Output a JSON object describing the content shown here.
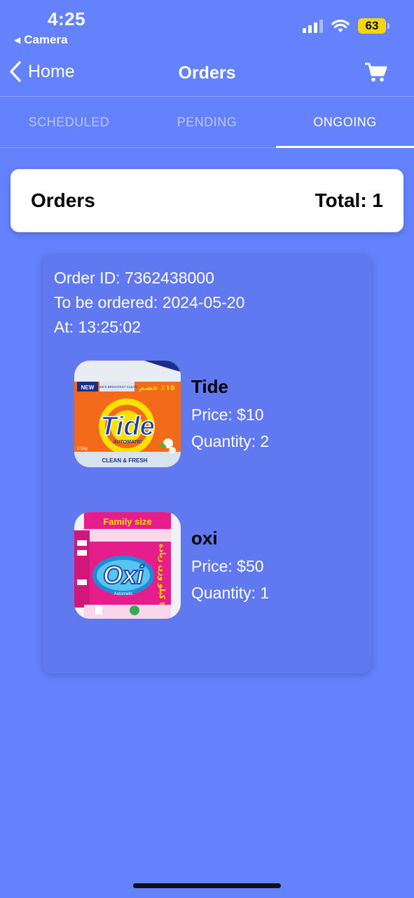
{
  "status_bar": {
    "time": "4:25",
    "back_app": "Camera",
    "battery": "63"
  },
  "nav": {
    "back_label": "Home",
    "title": "Orders",
    "cart_icon": "cart-icon"
  },
  "tabs": [
    {
      "label": "SCHEDULED",
      "active": false
    },
    {
      "label": "PENDING",
      "active": false
    },
    {
      "label": "ONGOING",
      "active": true
    }
  ],
  "summary": {
    "title": "Orders",
    "total": "Total: 1"
  },
  "order": {
    "id_line": "Order ID: 7362438000",
    "date_line": "To be ordered: 2024-05-20",
    "time_line": "At: 13:25:02",
    "items": [
      {
        "name": "Tide",
        "price": "Price: $10",
        "quantity": "Quantity: 2",
        "image": {
          "brand": "Tide",
          "sub": "AUTOMATIC",
          "badge": "NEW",
          "footer": "CLEAN & FRESH",
          "weight": "2.5kg",
          "arabic": "١٥٪ خصم",
          "tagline": "TIDE'S BRIGHTEST CLEAN"
        }
      },
      {
        "name": "oxi",
        "price": "Price: $50",
        "quantity": "Quantity: 1",
        "image": {
          "brand": "Oxi",
          "banner": "Family size",
          "arabic": "٢ كيلو وزن زيادة",
          "sub": "Automatic"
        }
      }
    ]
  },
  "colors": {
    "background": "#6382FC",
    "card": "#6078F0",
    "battery": "#F5D410"
  }
}
